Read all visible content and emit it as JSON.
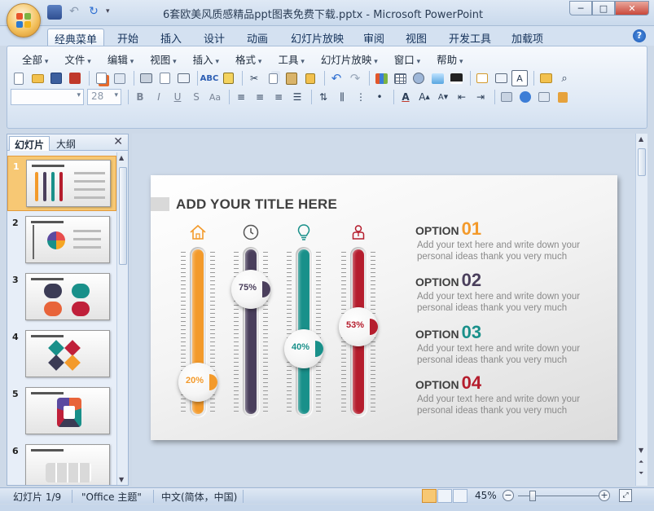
{
  "window": {
    "title": "6套欧美风质感精品ppt图表免费下载.pptx - Microsoft PowerPoint",
    "controls": [
      "─",
      "□",
      "✕"
    ]
  },
  "ribbon": {
    "tabs": [
      "经典菜单",
      "开始",
      "插入",
      "设计",
      "动画",
      "幻灯片放映",
      "审阅",
      "视图",
      "开发工具",
      "加载项"
    ],
    "active_tab": "经典菜单",
    "classic_menu": [
      "全部",
      "文件",
      "编辑",
      "视图",
      "插入",
      "格式",
      "工具",
      "幻灯片放映",
      "窗口",
      "帮助"
    ],
    "font_name": "",
    "font_size": "28",
    "format_buttons": [
      "B",
      "I",
      "U",
      "S",
      "Aa"
    ]
  },
  "left_pane": {
    "tabs": [
      "幻灯片",
      "大纲"
    ],
    "active_tab": "幻灯片",
    "close": "✕",
    "slide_numbers": [
      "1",
      "2",
      "3",
      "4",
      "5",
      "6"
    ],
    "selected": "1"
  },
  "slide": {
    "title": "ADD YOUR TITLE HERE",
    "gauges": [
      {
        "icon": "home-icon",
        "percent_label": "20%",
        "value": 0.2,
        "color": "#f39a2b"
      },
      {
        "icon": "clock-icon",
        "percent_label": "75%",
        "value": 0.75,
        "color": "#4a3f5c"
      },
      {
        "icon": "lightbulb-icon",
        "percent_label": "40%",
        "value": 0.4,
        "color": "#19908a"
      },
      {
        "icon": "person-icon",
        "percent_label": "53%",
        "value": 0.53,
        "color": "#b51d2d"
      }
    ],
    "options": [
      {
        "label": "OPTION",
        "number": "01",
        "color": "#f39a2b",
        "desc_line1": "Add your text here and write down your",
        "desc_line2": "personal ideas thank you very  much"
      },
      {
        "label": "OPTION",
        "number": "02",
        "color": "#4a3f5c",
        "desc_line1": "Add your text here and write down your",
        "desc_line2": "personal ideas thank you very  much"
      },
      {
        "label": "OPTION",
        "number": "03",
        "color": "#19908a",
        "desc_line1": "Add your text here and write down your",
        "desc_line2": "personal ideas thank you very  much"
      },
      {
        "label": "OPTION",
        "number": "04",
        "color": "#b51d2d",
        "desc_line1": "Add your text here and write down your",
        "desc_line2": "personal ideas thank you very  much"
      }
    ]
  },
  "status": {
    "slide_info": "幻灯片 1/9",
    "theme": "\"Office 主题\"",
    "language": "中文(简体，中国)",
    "zoom": "45%",
    "zoom_minus": "−",
    "zoom_plus": "+"
  }
}
